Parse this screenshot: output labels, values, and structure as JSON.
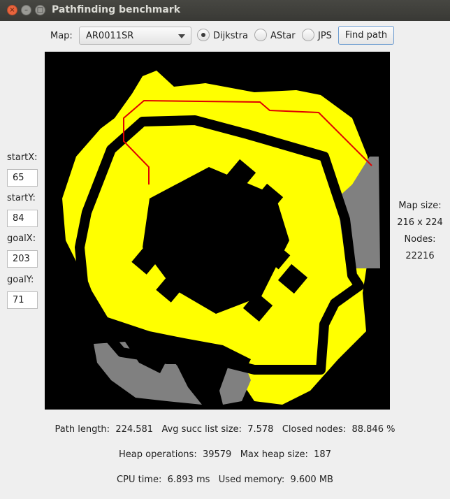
{
  "window": {
    "title": "Pathfinding benchmark"
  },
  "toolbar": {
    "map_label": "Map:",
    "map_selected": "AR0011SR",
    "algorithms": [
      {
        "label": "Dijkstra",
        "selected": true
      },
      {
        "label": "AStar",
        "selected": false
      },
      {
        "label": "JPS",
        "selected": false
      }
    ],
    "find_path_label": "Find path"
  },
  "inputs": {
    "start_x": {
      "label": "startX:",
      "value": "65"
    },
    "start_y": {
      "label": "startY:",
      "value": "84"
    },
    "goal_x": {
      "label": "goalX:",
      "value": "203"
    },
    "goal_y": {
      "label": "goalY:",
      "value": "71"
    }
  },
  "info": {
    "map_size_label": "Map size:",
    "map_size_value": "216 x 224",
    "nodes_label": "Nodes:",
    "nodes_value": "22216"
  },
  "stats": {
    "line1": "Path length:  224.581   Avg succ list size:  7.578   Closed nodes:  88.846 %",
    "line2": "Heap operations:  39579   Max heap size:  187",
    "line3": "CPU time:  6.893 ms   Used memory:  9.600 MB"
  },
  "colors": {
    "blocked": "#000000",
    "closed_set": "#ffff00",
    "unvisited": "#808080",
    "path": "#e00000",
    "focus_border": "#6b9bd0"
  }
}
